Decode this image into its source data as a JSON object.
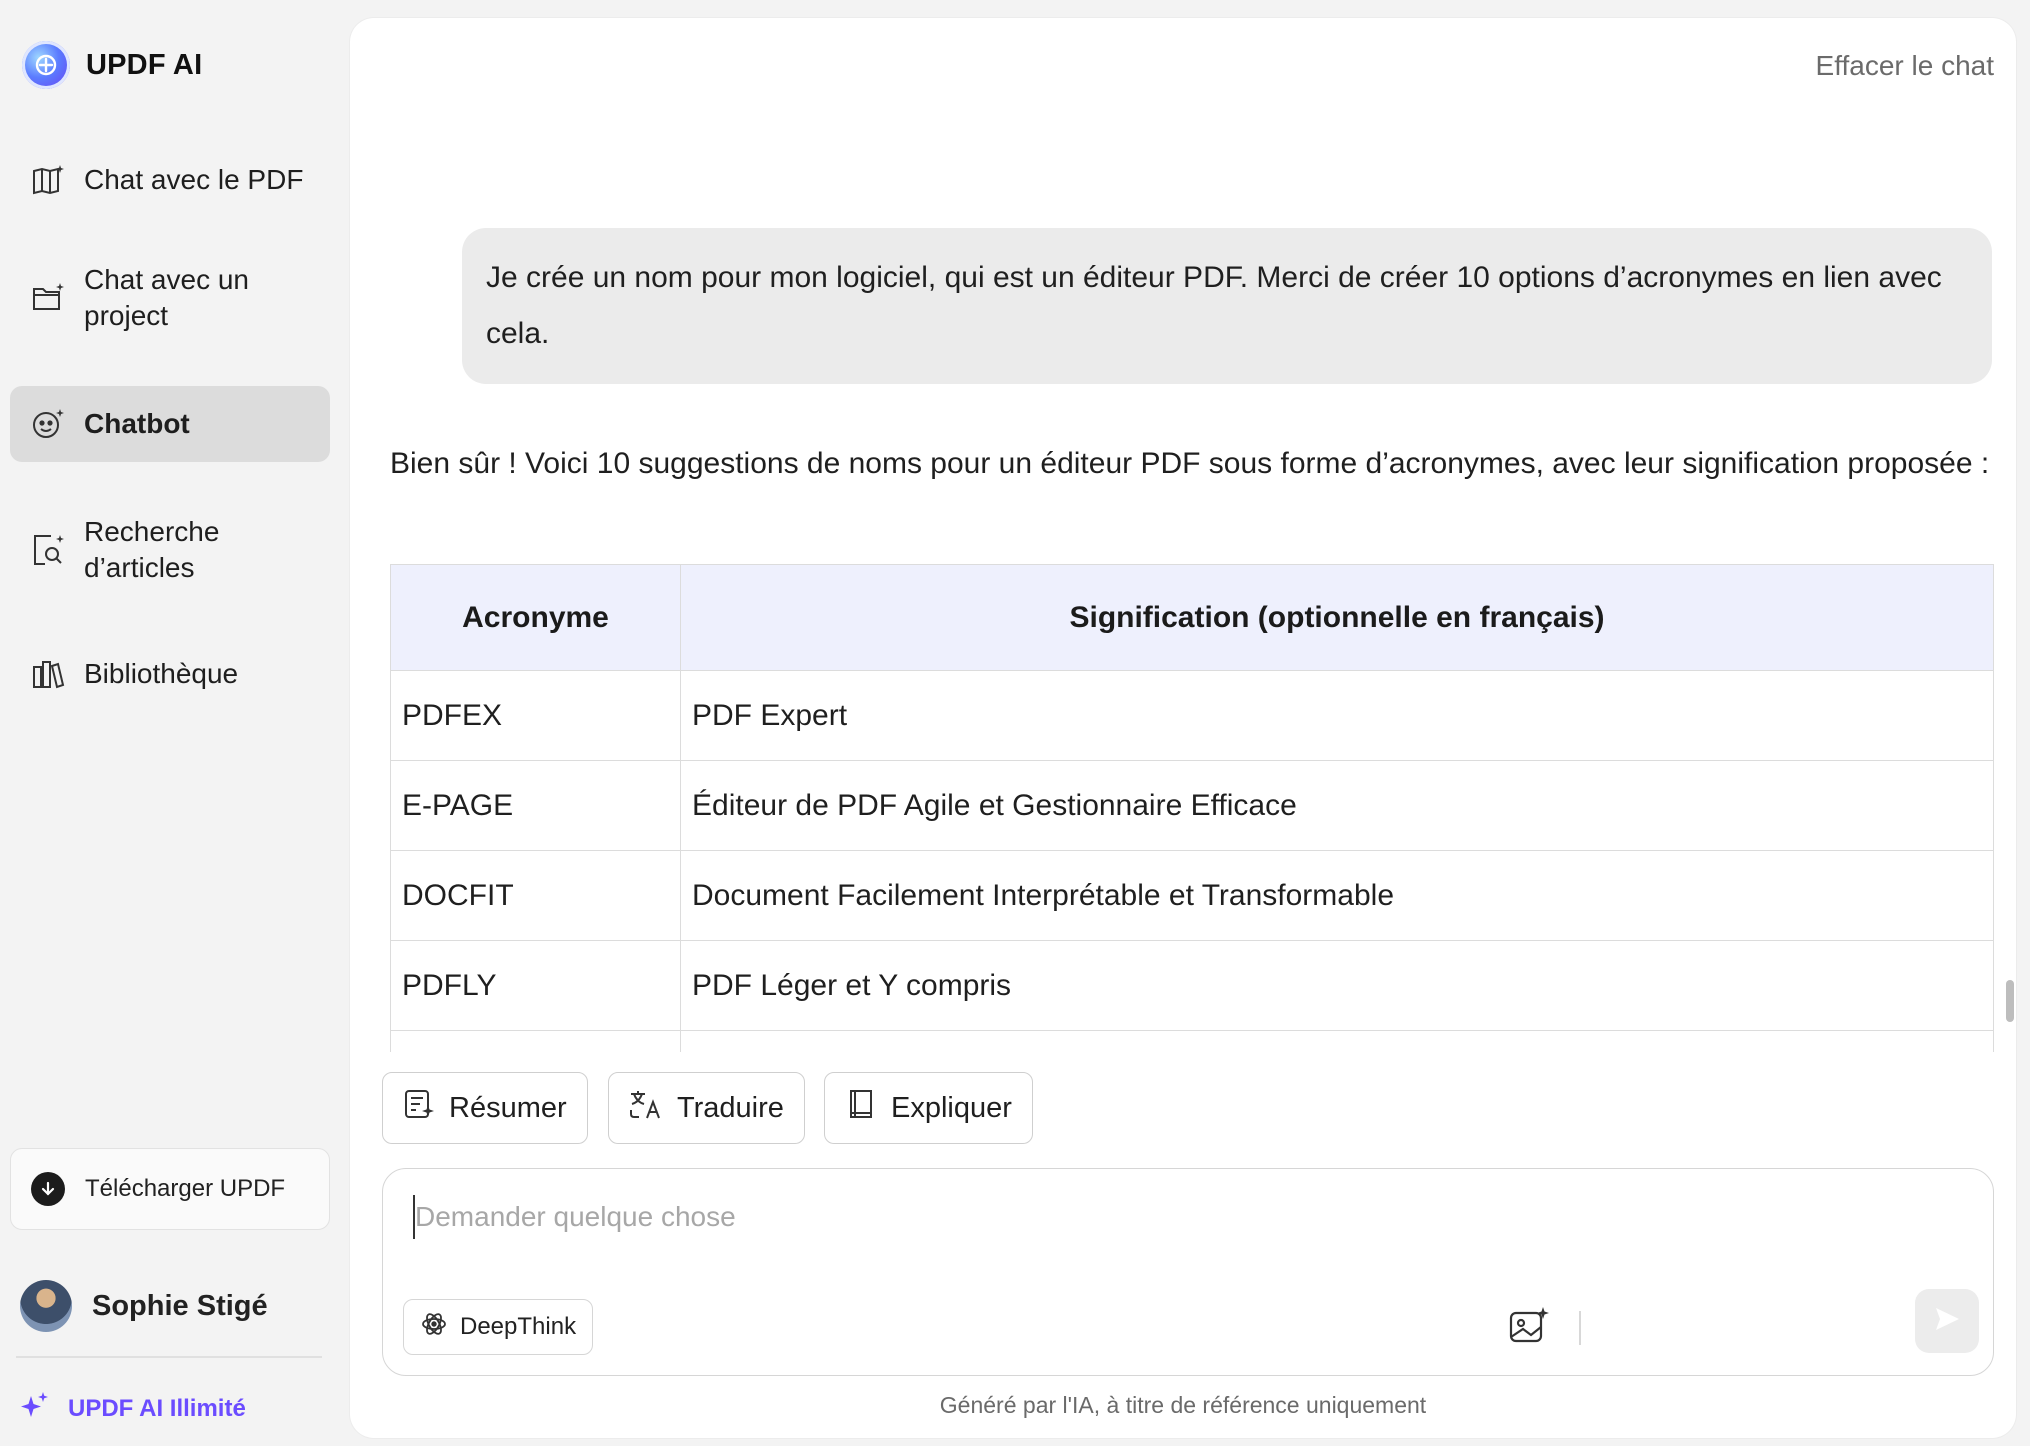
{
  "brand": {
    "name": "UPDF AI"
  },
  "sidebar": {
    "items": [
      {
        "label": "Chat avec le PDF",
        "icon": "book-sparkle-icon",
        "active": false
      },
      {
        "label": "Chat avec un project",
        "line1": "Chat avec un",
        "line2": "project",
        "icon": "folder-sparkle-icon",
        "active": false
      },
      {
        "label": "Chatbot",
        "icon": "bot-face-icon",
        "active": true
      },
      {
        "label": "Recherche d’articles",
        "line1": "Recherche",
        "line2": "d’articles",
        "icon": "doc-search-icon",
        "active": false
      },
      {
        "label": "Bibliothèque",
        "icon": "library-icon",
        "active": false
      }
    ],
    "download_label": "Télécharger UPDF",
    "user_name": "Sophie Stigé",
    "unlimited_label": "UPDF AI Illimité"
  },
  "header": {
    "clear_chat": "Effacer le chat"
  },
  "chat": {
    "user_message": "Je crée un nom pour mon logiciel, qui est un éditeur PDF. Merci de créer 10 options d’acronymes en lien avec cela.",
    "ai_intro": "Bien sûr ! Voici 10 suggestions de noms pour un éditeur PDF sous forme d’acronymes, avec leur signification proposée :",
    "table": {
      "headers": [
        "Acronyme",
        "Signification (optionnelle en français)"
      ],
      "rows": [
        [
          "PDFEX",
          "PDF Expert"
        ],
        [
          "E-PAGE",
          "Éditeur de PDF Agile et Gestionnaire Efficace"
        ],
        [
          "DOCFIT",
          "Document Facilement Interprétable et Transformable"
        ],
        [
          "PDFLY",
          "PDF Léger et Y compris"
        ]
      ]
    }
  },
  "actions": {
    "summarize": "Résumer",
    "translate": "Traduire",
    "explain": "Expliquer"
  },
  "composer": {
    "placeholder": "Demander quelque chose",
    "value": "",
    "deepthink_label": "DeepThink"
  },
  "footer": {
    "note": "Généré par l'IA, à titre de référence uniquement"
  },
  "colors": {
    "accent": "#6b4cff",
    "active_nav": "#dcdcdc",
    "table_header": "#eef0fd"
  }
}
